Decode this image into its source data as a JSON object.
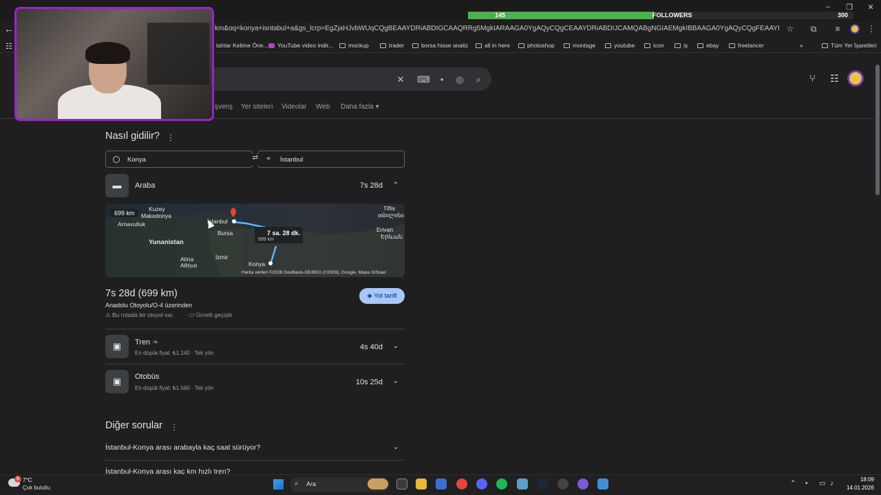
{
  "overlay": {
    "followers_count": "145",
    "followers_label": "FOLLOWERS",
    "followers_goal": "300",
    "followers_progress": 0.483,
    "bar_color": "#4caf50",
    "webcam_border_color": "#9b22c9"
  },
  "browser": {
    "url": "km&oq=konya+isntabul+a&gs_lcrp=EgZjaHJvbWUqCQgBEAAYDRiABDIGCAAQRRg5MgkIARAAGA0YgAQyCQgCEAAYDRiABDIJCAMQABgNGIAEMgkIBBAAGA0YgAQyCQgFEAAYDRiABDIJCAYQABgN..."
  },
  "bookmarks": {
    "items": [
      {
        "label": "tahtar Kelime Öne...",
        "icon": "folder-icon"
      },
      {
        "label": "YouTube video indir...",
        "icon": "youtube-icon"
      },
      {
        "label": "mockup",
        "icon": "folder-icon"
      },
      {
        "label": "trader",
        "icon": "folder-icon"
      },
      {
        "label": "borsa hisse analiz",
        "icon": "folder-icon"
      },
      {
        "label": "all in here",
        "icon": "folder-icon"
      },
      {
        "label": "photoshop",
        "icon": "folder-icon"
      },
      {
        "label": "montage",
        "icon": "folder-icon"
      },
      {
        "label": "youtube",
        "icon": "folder-icon"
      },
      {
        "label": "icon",
        "icon": "folder-icon"
      },
      {
        "label": "iş",
        "icon": "folder-icon"
      },
      {
        "label": "ebay",
        "icon": "folder-icon"
      },
      {
        "label": "freelancer",
        "icon": "folder-icon"
      }
    ],
    "more": "»",
    "all_bookmarks": "Tüm Yer İşaretleri"
  },
  "search": {
    "tabs": [
      "şveriş",
      "Yer siteleri",
      "Videolar",
      "Web",
      "Daha fazla ▾"
    ]
  },
  "directions": {
    "title": "Nasıl gidilir?",
    "origin": "Konya",
    "destination": "İstanbul",
    "car": {
      "label": "Araba",
      "time": "7s 28d"
    },
    "map": {
      "distance_badge": "699 km",
      "callout_time": "7 sa. 28 dk.",
      "callout_distance": "699 km",
      "labels": {
        "kuzey_makedonya_1": "Kuzey",
        "kuzey_makedonya_2": "Makedonya",
        "arnavutluk": "Arnavutluk",
        "yunanistan": "Yunanistan",
        "atina": "Atina",
        "athina": "Αθήνα",
        "istanbul": "İstanbul",
        "bursa": "Bursa",
        "izmir": "İzmir",
        "konya": "Konya",
        "tiflis": "Tiflis",
        "tbilisi": "თბილისი",
        "erivan": "Erivan",
        "yerevan": "Երևան"
      },
      "attribution": "Harita verileri ©2026 GeoBasis-DE/BKG (©2009), Google, Mapa GISrael"
    },
    "summary": "7s 28d (699 km)",
    "via": "Anadolu Otoyolu/O-4 üzerinden",
    "warning_highway": "Bu rotada bir otoyol var.",
    "warning_toll": "Ücretli geçişlir",
    "button_label": "Yol tarifi",
    "train": {
      "label": "Tren",
      "sub": "En düşük fiyat: ₺1.140 · Tek yön",
      "time": "4s 40d"
    },
    "bus": {
      "label": "Otobüs",
      "sub": "En düşük fiyat: ₺1.560 · Tek yön",
      "time": "10s 25d"
    }
  },
  "other_questions": {
    "title": "Diğer sorular",
    "items": [
      "İstanbul-Konya arası arabayla kaç saat sürüyor?",
      "İstanbul-Konya arası kaç km hızlı tren?"
    ]
  },
  "taskbar": {
    "weather_temp": "7°C",
    "weather_desc": "Çok bulutlu",
    "weather_badge": "6",
    "search_placeholder": "Ara",
    "time": "18:09",
    "date": "14.01.2026"
  }
}
